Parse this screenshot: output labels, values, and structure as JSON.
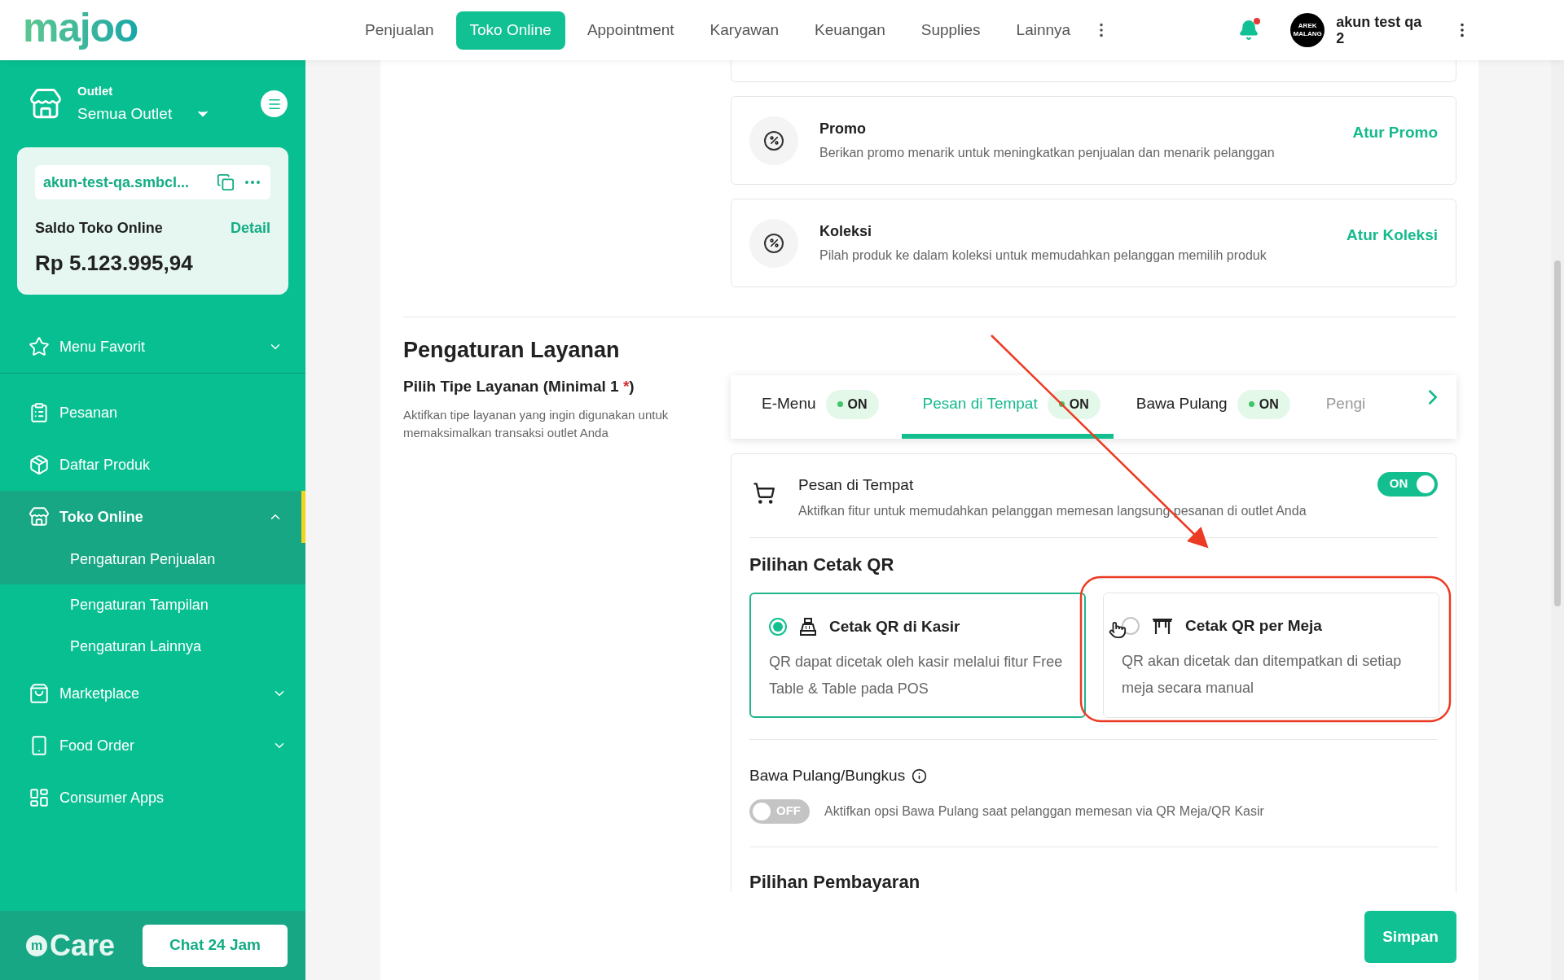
{
  "header": {
    "logo": "majoo",
    "nav": [
      {
        "label": "Penjualan",
        "selected": false
      },
      {
        "label": "Toko Online",
        "selected": true
      },
      {
        "label": "Appointment",
        "selected": false
      },
      {
        "label": "Karyawan",
        "selected": false
      },
      {
        "label": "Keuangan",
        "selected": false
      },
      {
        "label": "Supplies",
        "selected": false
      },
      {
        "label": "Lainnya",
        "selected": false
      }
    ],
    "notification": {
      "unread": true
    },
    "avatar_text": "AREK MALANG",
    "user": "akun test qa 2"
  },
  "sidebar": {
    "outlet": {
      "label": "Outlet",
      "value": "Semua Outlet"
    },
    "store": {
      "url": "akun-test-qa.smbcl...",
      "balance_label": "Saldo Toko Online",
      "detail": "Detail",
      "balance": "Rp 5.123.995,94"
    },
    "favorite": {
      "label": "Menu Favorit",
      "expanded": false
    },
    "items": [
      {
        "label": "Pesanan",
        "expandable": false,
        "expanded": false,
        "selected": false
      },
      {
        "label": "Daftar Produk",
        "expandable": false,
        "expanded": false,
        "selected": false
      },
      {
        "label": "Toko Online",
        "expandable": true,
        "expanded": true,
        "selected": true,
        "children": [
          {
            "label": "Pengaturan Penjualan",
            "selected": true
          },
          {
            "label": "Pengaturan Tampilan",
            "selected": false
          },
          {
            "label": "Pengaturan Lainnya",
            "selected": false
          }
        ]
      },
      {
        "label": "Marketplace",
        "expandable": true,
        "expanded": false,
        "selected": false
      },
      {
        "label": "Food Order",
        "expandable": true,
        "expanded": false,
        "selected": false
      },
      {
        "label": "Consumer Apps",
        "expandable": false,
        "expanded": false,
        "selected": false
      }
    ],
    "care": {
      "mark": "m",
      "label": "Care"
    },
    "chat_button": "Chat 24 Jam"
  },
  "features": [
    {
      "title": "Promo",
      "description": "Berikan promo menarik untuk meningkatkan penjualan dan menarik pelanggan",
      "action": "Atur Promo"
    },
    {
      "title": "Koleksi",
      "description": "Pilah produk ke dalam koleksi untuk memudahkan pelanggan memilih produk",
      "action": "Atur Koleksi"
    }
  ],
  "service": {
    "title": "Pengaturan Layanan",
    "label": "Pilih Tipe Layanan (Minimal 1 ",
    "required_mark": "*",
    "label_end": ")",
    "description": "Aktifkan tipe layanan yang ingin digunakan untuk memaksimalkan transaksi outlet Anda",
    "tabs": [
      {
        "label": "E-Menu",
        "status": "ON",
        "on": true,
        "selected": false
      },
      {
        "label": "Pesan di Tempat",
        "status": "ON",
        "on": true,
        "selected": true
      },
      {
        "label": "Bawa Pulang",
        "status": "ON",
        "on": true,
        "selected": false
      },
      {
        "label": "Pengi",
        "selected": false
      }
    ],
    "panel": {
      "title": "Pesan di Tempat",
      "description": "Aktifkan fitur untuk memudahkan pelanggan memesan langsung pesanan di outlet Anda",
      "toggle": {
        "on": true,
        "label": "ON"
      },
      "qr": {
        "title": "Pilihan Cetak QR",
        "options": [
          {
            "title": "Cetak QR di Kasir",
            "description": "QR dapat dicetak oleh kasir melalui fitur Free Table & Table pada POS",
            "selected": true
          },
          {
            "title": "Cetak QR per Meja",
            "description": "QR akan dicetak dan ditempatkan di setiap meja secara manual",
            "selected": false
          }
        ]
      },
      "takeaway": {
        "title": "Bawa Pulang/Bungkus",
        "toggle": {
          "on": false,
          "label": "OFF"
        },
        "description": "Aktifkan opsi Bawa Pulang saat pelanggan memesan via QR Meja/QR Kasir"
      },
      "payment_title": "Pilihan Pembayaran"
    }
  },
  "save_button": "Simpan"
}
